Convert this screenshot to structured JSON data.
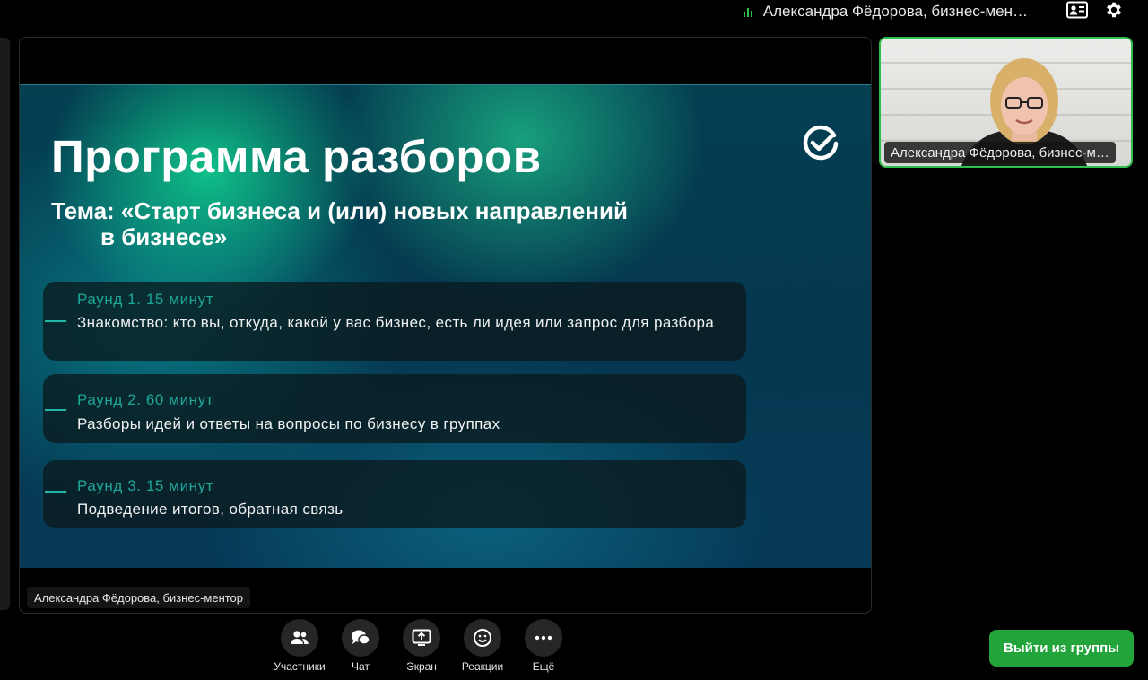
{
  "header": {
    "speaker_name": "Александра Фёдорова, бизнес-мен…",
    "view_icon": "participant-card-icon",
    "settings_icon": "gear-icon"
  },
  "slide": {
    "title": "Программа разборов",
    "subtitle_line1": "Тема: «Старт бизнеса и (или) новых направлений",
    "subtitle_line2": "в бизнесе»",
    "logo_icon": "check-circle-icon",
    "rounds": [
      {
        "heading": "Раунд 1. 15 минут",
        "text": "Знакомство: кто вы, откуда, какой у вас бизнес, есть ли идея или запрос для разбора"
      },
      {
        "heading": "Раунд 2. 60 минут",
        "text": "Разборы идей и ответы на вопросы по бизнесу в группах"
      },
      {
        "heading": "Раунд 3. 15 минут",
        "text": "Подведение итогов, обратная связь"
      }
    ]
  },
  "share_owner_tag": "Александра Фёдорова, бизнес-ментор",
  "participant": {
    "name_tag": "Александра Фёдорова, бизнес-м…"
  },
  "toolbar": {
    "participants": "Участники",
    "chat": "Чат",
    "screen": "Экран",
    "reactions": "Реакции",
    "more": "Ещё"
  },
  "leave_button": "Выйти из группы",
  "colors": {
    "accent_green": "#22a43a",
    "speaking_border": "#2fbf4f",
    "round_heading": "#1ea799"
  }
}
